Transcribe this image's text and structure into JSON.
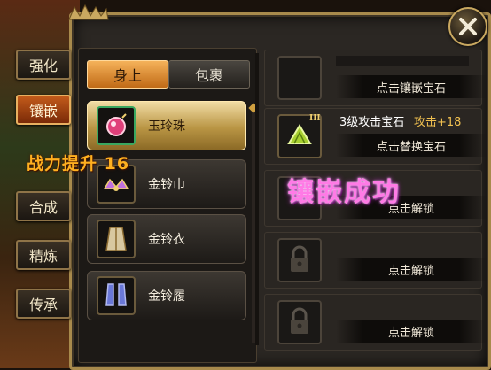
{
  "side_tabs": [
    {
      "label": "强化",
      "active": false
    },
    {
      "label": "镶嵌",
      "active": true
    },
    {
      "label": "合成",
      "active": false
    },
    {
      "label": "精炼",
      "active": false
    },
    {
      "label": "传承",
      "active": false
    }
  ],
  "toggle": {
    "on_label": "身上",
    "off_label": "包裹"
  },
  "items": [
    {
      "name": "玉玲珠",
      "icon": "jade-bead-icon",
      "selected": true
    },
    {
      "name": "金铃巾",
      "icon": "headband-icon",
      "selected": false
    },
    {
      "name": "金铃衣",
      "icon": "robe-icon",
      "selected": false
    },
    {
      "name": "金铃履",
      "icon": "boots-icon",
      "selected": false
    }
  ],
  "slots": [
    {
      "state": "empty",
      "action": "点击镶嵌宝石"
    },
    {
      "state": "gem",
      "gem_name": "3级攻击宝石",
      "gem_stat": "攻击+18",
      "gem_level_badge": "III",
      "action": "点击替换宝石"
    },
    {
      "state": "locked",
      "action": "点击解锁"
    },
    {
      "state": "locked",
      "action": "点击解锁"
    },
    {
      "state": "locked",
      "action": "点击解锁"
    }
  ],
  "notifications": {
    "power_up": "战力提升 16",
    "embed_success": "镶嵌成功"
  },
  "colors": {
    "frame_gold": "#a88a4c",
    "active_tab": "#c25a1a",
    "gem_stat": "#f0c050",
    "success_text": "#ff7ae6",
    "power_text": "#ffb020"
  }
}
